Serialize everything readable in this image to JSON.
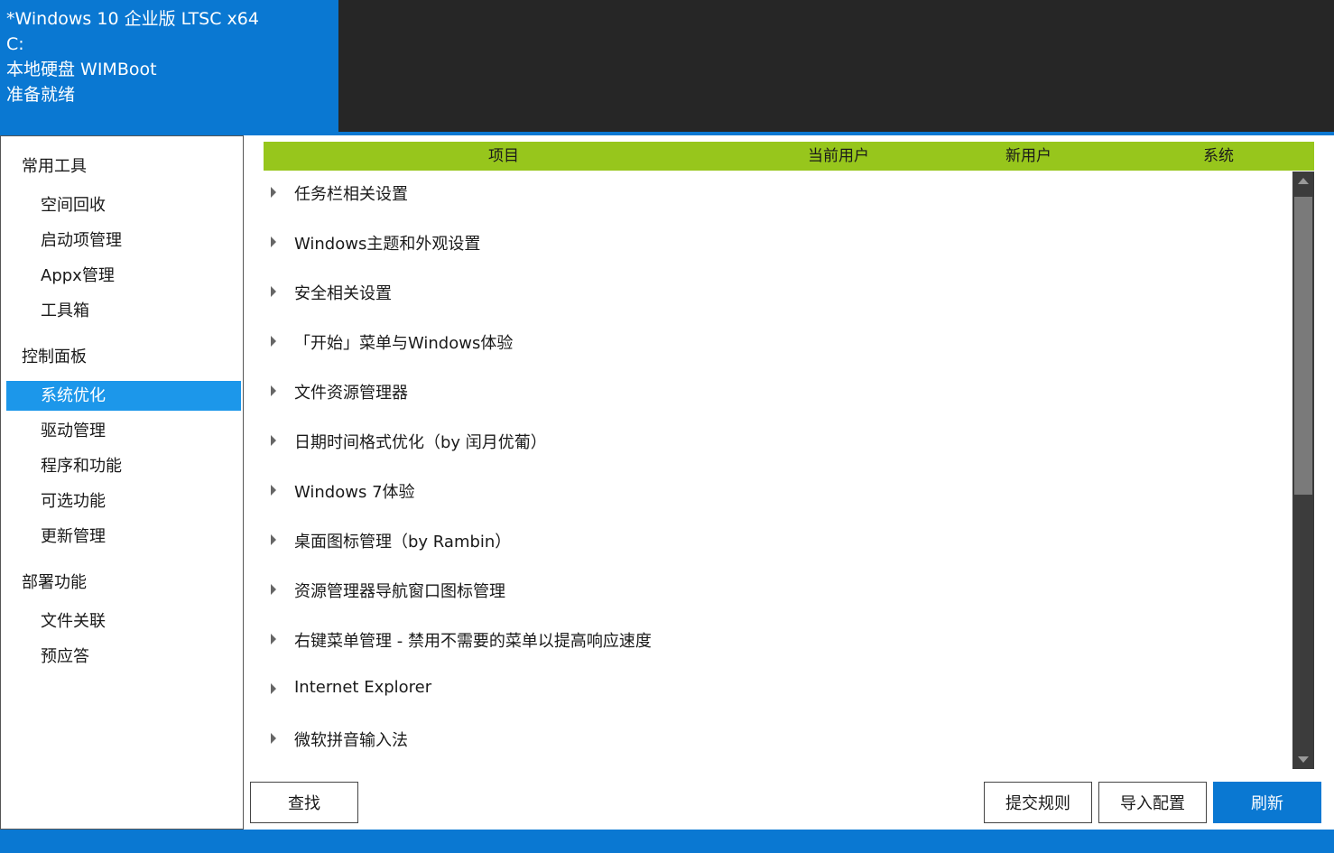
{
  "header": {
    "line1": "*Windows 10 企业版 LTSC x64",
    "line2": "C:",
    "line3": "本地硬盘 WIMBoot",
    "line4": "准备就绪"
  },
  "sidebar": {
    "groups": [
      {
        "label": "常用工具",
        "items": [
          "空间回收",
          "启动项管理",
          "Appx管理",
          "工具箱"
        ]
      },
      {
        "label": "控制面板",
        "items": [
          "系统优化",
          "驱动管理",
          "程序和功能",
          "可选功能",
          "更新管理"
        ]
      },
      {
        "label": "部署功能",
        "items": [
          "文件关联",
          "预应答"
        ]
      }
    ],
    "active_item": "系统优化"
  },
  "table": {
    "columns": [
      "项目",
      "当前用户",
      "新用户",
      "系统"
    ],
    "rows": [
      "任务栏相关设置",
      "Windows主题和外观设置",
      "安全相关设置",
      "「开始」菜单与Windows体验",
      "文件资源管理器",
      "日期时间格式优化（by 闰月优葡）",
      "Windows 7体验",
      "桌面图标管理（by Rambin）",
      "资源管理器导航窗口图标管理",
      "右键菜单管理 - 禁用不需要的菜单以提高响应速度",
      "Internet Explorer",
      "微软拼音输入法"
    ]
  },
  "buttons": {
    "find": "查找",
    "submit_rules": "提交规则",
    "import_config": "导入配置",
    "refresh": "刷新"
  },
  "colors": {
    "accent": "#0a78d2",
    "header_dark": "#262626",
    "table_header": "#97c61c",
    "selection": "#1c97ea"
  }
}
